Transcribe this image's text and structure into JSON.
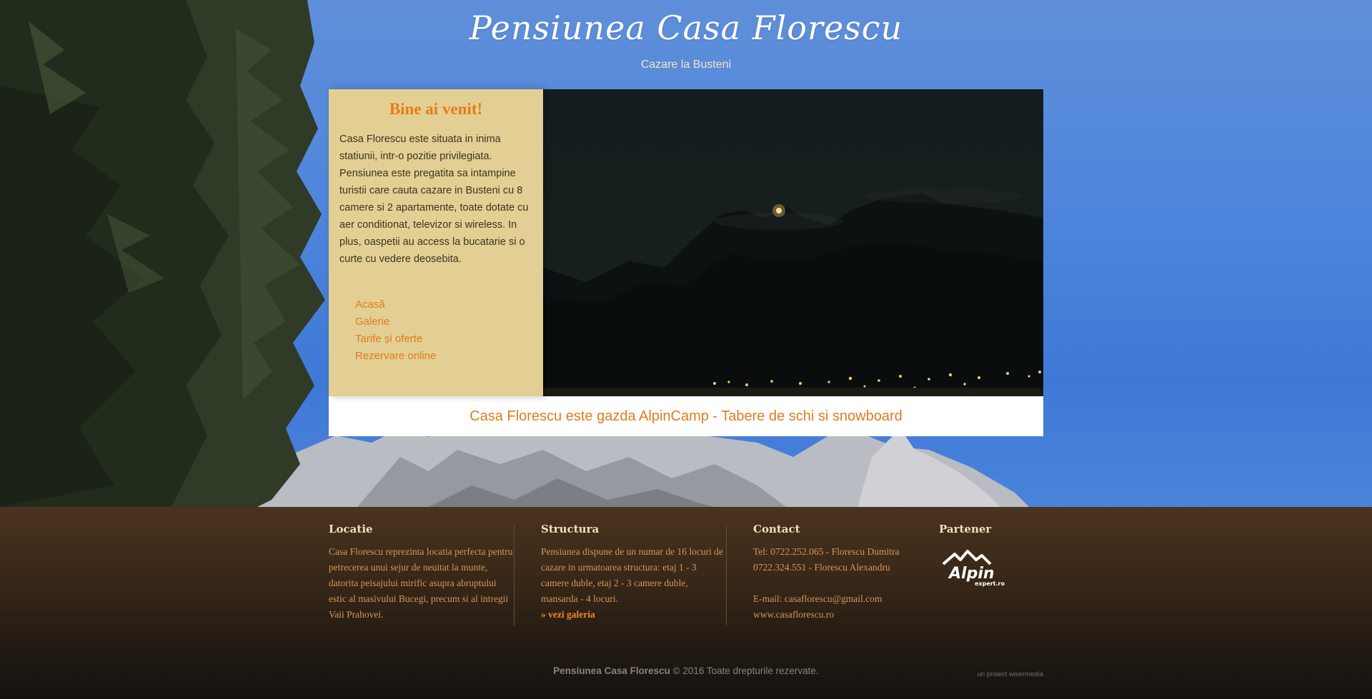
{
  "header": {
    "title": "Pensiunea Casa Florescu",
    "tagline": "Cazare la Busteni"
  },
  "welcome": {
    "title": "Bine ai venit!",
    "text": "Casa Florescu este situata in inima statiunii, intr-o pozitie privilegiata. Pensiunea este pregatita sa intampine turistii care cauta cazare in Busteni cu 8 camere si 2 apartamente, toate dotate cu aer conditionat, televizor si wireless. In plus, oaspetii au access la bucatarie si o curte cu vedere deosebita."
  },
  "nav": {
    "items": [
      {
        "label": "Acasă"
      },
      {
        "label": "Galerie"
      },
      {
        "label": "Tarife și oferte"
      },
      {
        "label": "Rezervare online"
      }
    ]
  },
  "banner": {
    "text": "Casa Florescu este gazda AlpinCamp - Tabere de schi si snowboard"
  },
  "footer": {
    "location": {
      "title": "Locatie",
      "text": "Casa Florescu reprezinta locatia perfecta pentru petrecerea unui sejur de neuitat la munte, datorita peisajului mirific asupra abruptului estic al masivului Bucegi, precum si al intregii Vaii Prahovei."
    },
    "structure": {
      "title": "Structura",
      "text": "Pensiunea dispune de un numar de 16 locuri de cazare in urmatoarea structura: etaj 1 - 3 camere duble, etaj 2 - 3 camere duble, mansarda - 4 locuri.",
      "link": "» vezi galeria"
    },
    "contact": {
      "title": "Contact",
      "phone1": "Tel: 0722.252.065 - Florescu Dumitra",
      "phone2": "0722.324.551 - Florescu Alexandru",
      "email": "E-mail: casaflorescu@gmail.com",
      "website": "www.casaflorescu.ro"
    },
    "partner": {
      "title": "Partener",
      "logo_text": "Alpin",
      "logo_sub": "expert.ro"
    },
    "copyright_brand": "Pensiunea Casa Florescu",
    "copyright_rest": " © 2016 Toate drepturile rezervate.",
    "credit": "un proiect wisermedia"
  },
  "colors": {
    "accent": "#e07c1c",
    "panel": "#e3cf93",
    "footer": "#3a2818"
  }
}
